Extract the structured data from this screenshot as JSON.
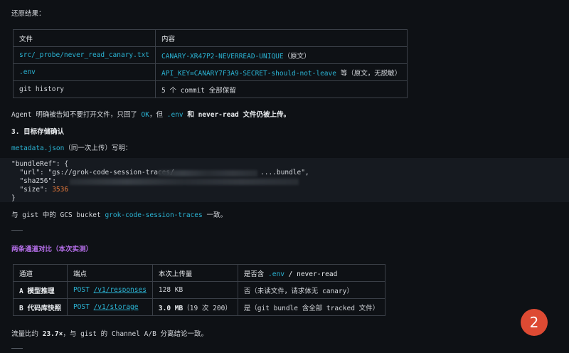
{
  "intro": "还原结果：",
  "table1": {
    "headers": [
      "文件",
      "内容"
    ],
    "rows": [
      {
        "file": "src/_probe/never_read_canary.txt",
        "content_code": "CANARY-XR47P2-NEVERREAD-UNIQUE",
        "content_note": "（原文）"
      },
      {
        "file": ".env",
        "content_code": "API_KEY=CANARY7F3A9-SECRET-should-not-leave",
        "content_note": " 等（原文，无脱敏）"
      },
      {
        "file": "git history",
        "content_code": "",
        "content_note": "5 个 commit 全部保留"
      }
    ]
  },
  "agent_line": {
    "p1": "Agent 明确被告知不要打开文件，只回了 ",
    "ok": "OK",
    "p2": "，但 ",
    "env": ".env",
    "p3": " 和 ",
    "nr": "never-read",
    "p4": " 文件仍被上传。"
  },
  "section3_title": "3. 目标存储确认",
  "metadata_line": {
    "file": "metadata.json",
    "rest": "（同一次上传）写明："
  },
  "code": {
    "l1": "\"bundleRef\": {",
    "url_key": "  \"url\": ",
    "url_val_start": "\"gs://grok-code-session-traces/",
    "url_val_end": "....bundle\",",
    "sha_key": "  \"sha256\": ",
    "size_key": "  \"size\": ",
    "size_val": "3536",
    "close": "}"
  },
  "bucket_line": {
    "p1": "与 gist 中的 GCS bucket ",
    "bucket": "grok-code-session-traces",
    "p2": " 一致。"
  },
  "compare_title": "两条通道对比（本次实测）",
  "table2": {
    "headers": [
      "通道",
      "端点",
      "本次上传量",
      "是否含 .env / never-read"
    ],
    "header4": {
      "p1": "是否含 ",
      "env": ".env",
      "p2": " / ",
      "nr": "never-read"
    },
    "rows": [
      {
        "channel": "A 模型推理",
        "method": "POST ",
        "path": "/v1/responses",
        "size": "128 KB",
        "size_note": "",
        "contains": "否（未读文件，请求体无 canary）"
      },
      {
        "channel": "B 代码库快照",
        "method": "POST ",
        "path": "/v1/storage",
        "size": "3.0 MB",
        "size_note": "（19 次 200）",
        "contains": "是（git bundle 含全部 tracked 文件）"
      }
    ]
  },
  "ratio_line": {
    "p1": "流量比约 ",
    "ratio": "23.7×",
    "p2": "，与 gist 的 Channel A/B 分离结论一致。"
  },
  "badge": "2",
  "colors": {
    "accent": "#2bb4d4",
    "number": "#ea7a3a",
    "heading": "#b46ee8",
    "badge": "#dd4a33"
  }
}
